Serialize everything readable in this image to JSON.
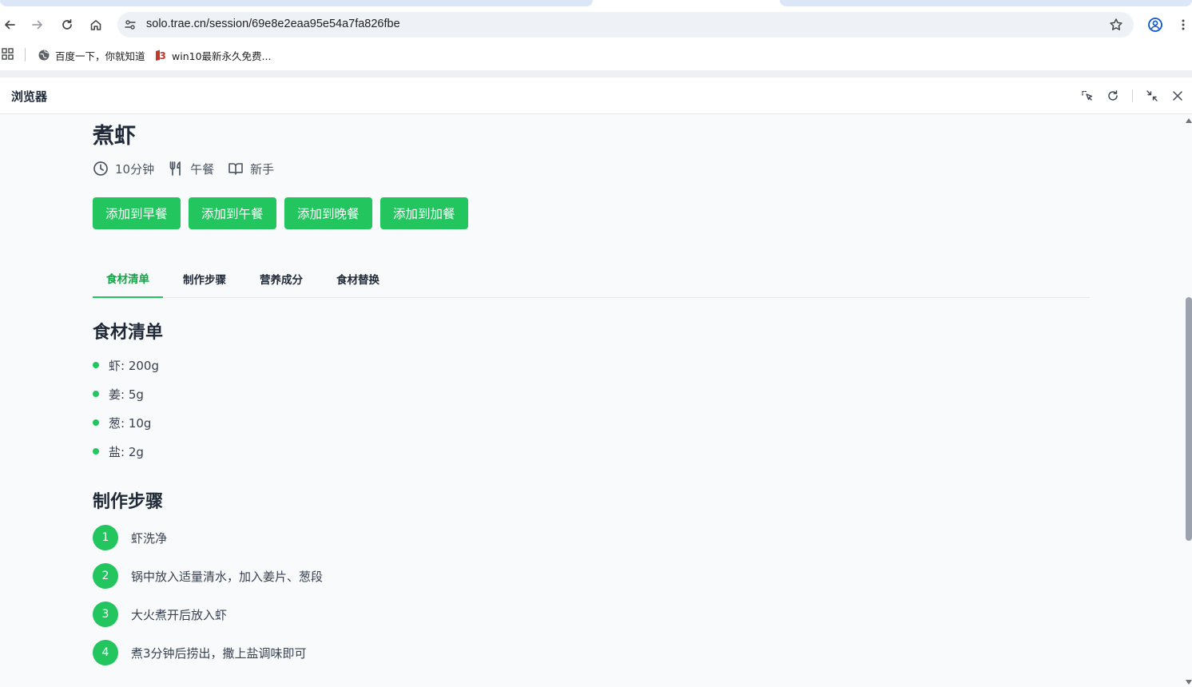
{
  "browser": {
    "url": "solo.trae.cn/session/69e8e2eaa95e54a7fa826fbe",
    "bookmarks": [
      {
        "label": "百度一下，你就知道",
        "icon": "globe-icon"
      },
      {
        "label": "win10最新永久免费...",
        "icon": "b-logo-icon"
      }
    ]
  },
  "panel": {
    "title": "浏览器",
    "actions": [
      "select-element-icon",
      "refresh-icon",
      "collapse-icon",
      "close-icon"
    ]
  },
  "recipe": {
    "title": "煮虾",
    "meta": {
      "time": "10分钟",
      "meal": "午餐",
      "difficulty": "新手"
    },
    "add_buttons": [
      "添加到早餐",
      "添加到午餐",
      "添加到晚餐",
      "添加到加餐"
    ],
    "tabs": [
      "食材清单",
      "制作步骤",
      "营养成分",
      "食材替换"
    ],
    "active_tab_index": 0,
    "ingredients_title": "食材清单",
    "ingredients": [
      "虾: 200g",
      "姜: 5g",
      "葱: 10g",
      "盐: 2g"
    ],
    "steps_title": "制作步骤",
    "steps": [
      {
        "num": "1",
        "text": "虾洗净"
      },
      {
        "num": "2",
        "text": "锅中放入适量清水，加入姜片、葱段"
      },
      {
        "num": "3",
        "text": "大火煮开后放入虾"
      },
      {
        "num": "4",
        "text": "煮3分钟后捞出，撒上盐调味即可"
      }
    ]
  },
  "colors": {
    "accent": "#22c55e",
    "accent_text": "#16a34a",
    "content_bg": "#f9fafb"
  }
}
